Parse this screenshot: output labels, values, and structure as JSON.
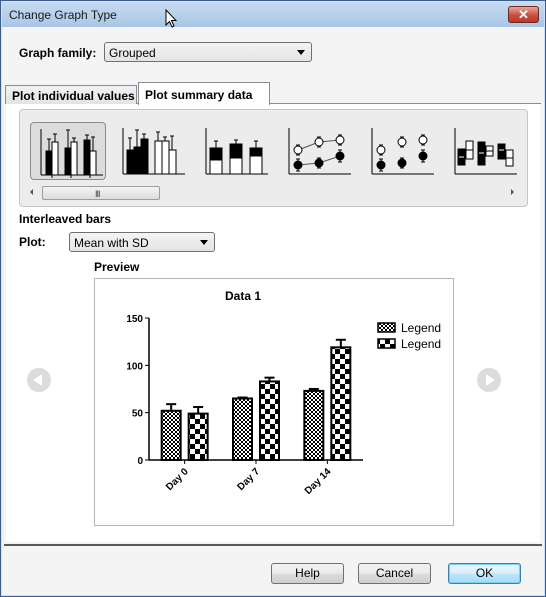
{
  "window": {
    "title": "Change Graph Type",
    "close_label": "✕"
  },
  "graph_family": {
    "label": "Graph family:",
    "value": "Grouped"
  },
  "tabs": [
    {
      "label": "Plot individual values",
      "active": false
    },
    {
      "label": "Plot summary data",
      "active": true
    }
  ],
  "gallery": {
    "selected_index": 0,
    "items": [
      {
        "name": "interleaved-bars",
        "selected": true
      },
      {
        "name": "separated-bars",
        "selected": false
      },
      {
        "name": "stacked-bars",
        "selected": false
      },
      {
        "name": "connected-points",
        "selected": false
      },
      {
        "name": "scatter-points",
        "selected": false
      },
      {
        "name": "floating-boxes",
        "selected": false
      }
    ],
    "scroll_grip": "III"
  },
  "selection_title": "Interleaved bars",
  "plot": {
    "label": "Plot:",
    "value": "Mean with SD"
  },
  "preview": {
    "label": "Preview"
  },
  "chart_data": {
    "type": "bar",
    "title": "Data 1",
    "xlabel": "",
    "ylabel": "",
    "categories": [
      "Day 0",
      "Day 7",
      "Day 14"
    ],
    "series": [
      {
        "name": "Legend",
        "pattern": "fine-checker",
        "values": [
          52,
          65,
          73
        ],
        "sd": [
          7,
          1,
          2
        ]
      },
      {
        "name": "Legend",
        "pattern": "coarse-checker",
        "values": [
          49,
          83,
          119
        ],
        "sd": [
          7,
          4,
          8
        ]
      }
    ],
    "ylim": [
      0,
      150
    ],
    "yticks": [
      0,
      50,
      100,
      150
    ],
    "grid": false,
    "legend_position": "top-right",
    "xtick_rotation_deg": -45
  },
  "buttons": {
    "help": "Help",
    "cancel": "Cancel",
    "ok": "OK"
  }
}
